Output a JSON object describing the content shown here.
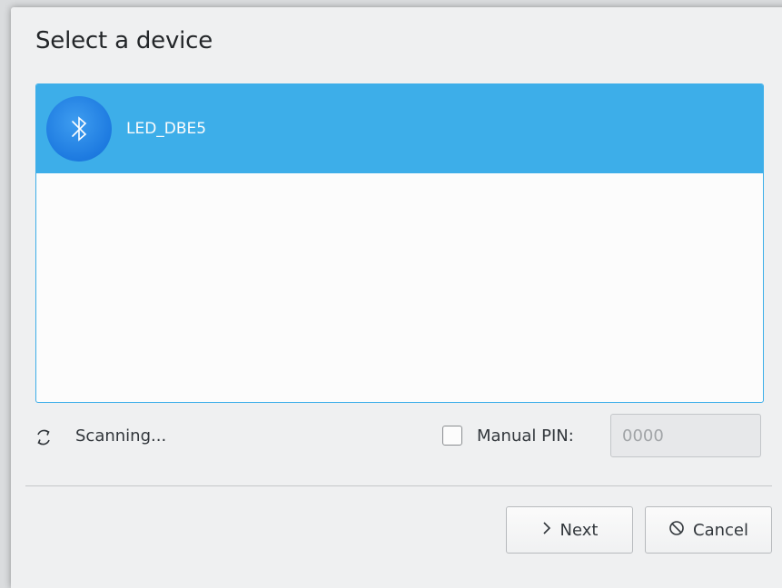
{
  "dialog": {
    "title": "Select a device"
  },
  "devices": [
    {
      "name": "LED_DBE5",
      "icon": "bluetooth-icon",
      "selected": true
    }
  ],
  "status": {
    "text": "Scanning...",
    "icon": "refresh-icon"
  },
  "manual_pin": {
    "label": "Manual PIN:",
    "checked": false,
    "value": "0000"
  },
  "buttons": {
    "next_label": "Next",
    "next_icon": "chevron-right-icon",
    "cancel_label": "Cancel",
    "cancel_icon": "cancel-icon"
  },
  "colors": {
    "selection": "#3daee9",
    "bluetooth_badge": "#1d7ae0"
  }
}
